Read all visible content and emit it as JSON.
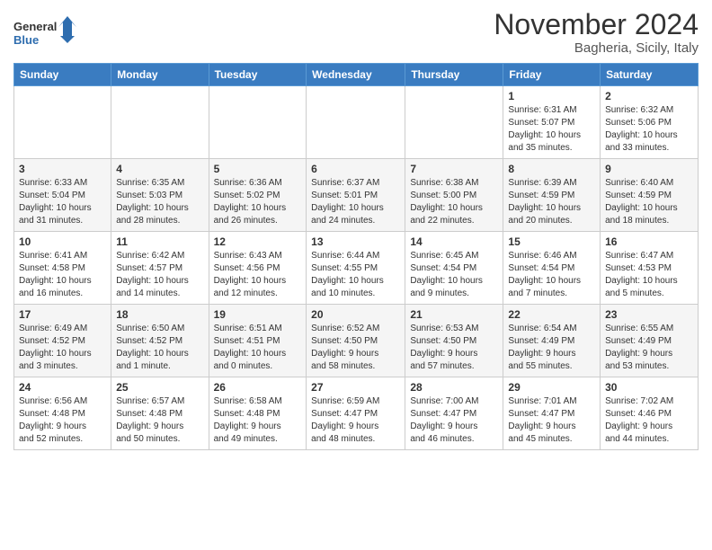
{
  "header": {
    "logo_general": "General",
    "logo_blue": "Blue",
    "month_title": "November 2024",
    "location": "Bagheria, Sicily, Italy"
  },
  "days_of_week": [
    "Sunday",
    "Monday",
    "Tuesday",
    "Wednesday",
    "Thursday",
    "Friday",
    "Saturday"
  ],
  "weeks": [
    [
      {
        "day": "",
        "info": ""
      },
      {
        "day": "",
        "info": ""
      },
      {
        "day": "",
        "info": ""
      },
      {
        "day": "",
        "info": ""
      },
      {
        "day": "",
        "info": ""
      },
      {
        "day": "1",
        "info": "Sunrise: 6:31 AM\nSunset: 5:07 PM\nDaylight: 10 hours\nand 35 minutes."
      },
      {
        "day": "2",
        "info": "Sunrise: 6:32 AM\nSunset: 5:06 PM\nDaylight: 10 hours\nand 33 minutes."
      }
    ],
    [
      {
        "day": "3",
        "info": "Sunrise: 6:33 AM\nSunset: 5:04 PM\nDaylight: 10 hours\nand 31 minutes."
      },
      {
        "day": "4",
        "info": "Sunrise: 6:35 AM\nSunset: 5:03 PM\nDaylight: 10 hours\nand 28 minutes."
      },
      {
        "day": "5",
        "info": "Sunrise: 6:36 AM\nSunset: 5:02 PM\nDaylight: 10 hours\nand 26 minutes."
      },
      {
        "day": "6",
        "info": "Sunrise: 6:37 AM\nSunset: 5:01 PM\nDaylight: 10 hours\nand 24 minutes."
      },
      {
        "day": "7",
        "info": "Sunrise: 6:38 AM\nSunset: 5:00 PM\nDaylight: 10 hours\nand 22 minutes."
      },
      {
        "day": "8",
        "info": "Sunrise: 6:39 AM\nSunset: 4:59 PM\nDaylight: 10 hours\nand 20 minutes."
      },
      {
        "day": "9",
        "info": "Sunrise: 6:40 AM\nSunset: 4:59 PM\nDaylight: 10 hours\nand 18 minutes."
      }
    ],
    [
      {
        "day": "10",
        "info": "Sunrise: 6:41 AM\nSunset: 4:58 PM\nDaylight: 10 hours\nand 16 minutes."
      },
      {
        "day": "11",
        "info": "Sunrise: 6:42 AM\nSunset: 4:57 PM\nDaylight: 10 hours\nand 14 minutes."
      },
      {
        "day": "12",
        "info": "Sunrise: 6:43 AM\nSunset: 4:56 PM\nDaylight: 10 hours\nand 12 minutes."
      },
      {
        "day": "13",
        "info": "Sunrise: 6:44 AM\nSunset: 4:55 PM\nDaylight: 10 hours\nand 10 minutes."
      },
      {
        "day": "14",
        "info": "Sunrise: 6:45 AM\nSunset: 4:54 PM\nDaylight: 10 hours\nand 9 minutes."
      },
      {
        "day": "15",
        "info": "Sunrise: 6:46 AM\nSunset: 4:54 PM\nDaylight: 10 hours\nand 7 minutes."
      },
      {
        "day": "16",
        "info": "Sunrise: 6:47 AM\nSunset: 4:53 PM\nDaylight: 10 hours\nand 5 minutes."
      }
    ],
    [
      {
        "day": "17",
        "info": "Sunrise: 6:49 AM\nSunset: 4:52 PM\nDaylight: 10 hours\nand 3 minutes."
      },
      {
        "day": "18",
        "info": "Sunrise: 6:50 AM\nSunset: 4:52 PM\nDaylight: 10 hours\nand 1 minute."
      },
      {
        "day": "19",
        "info": "Sunrise: 6:51 AM\nSunset: 4:51 PM\nDaylight: 10 hours\nand 0 minutes."
      },
      {
        "day": "20",
        "info": "Sunrise: 6:52 AM\nSunset: 4:50 PM\nDaylight: 9 hours\nand 58 minutes."
      },
      {
        "day": "21",
        "info": "Sunrise: 6:53 AM\nSunset: 4:50 PM\nDaylight: 9 hours\nand 57 minutes."
      },
      {
        "day": "22",
        "info": "Sunrise: 6:54 AM\nSunset: 4:49 PM\nDaylight: 9 hours\nand 55 minutes."
      },
      {
        "day": "23",
        "info": "Sunrise: 6:55 AM\nSunset: 4:49 PM\nDaylight: 9 hours\nand 53 minutes."
      }
    ],
    [
      {
        "day": "24",
        "info": "Sunrise: 6:56 AM\nSunset: 4:48 PM\nDaylight: 9 hours\nand 52 minutes."
      },
      {
        "day": "25",
        "info": "Sunrise: 6:57 AM\nSunset: 4:48 PM\nDaylight: 9 hours\nand 50 minutes."
      },
      {
        "day": "26",
        "info": "Sunrise: 6:58 AM\nSunset: 4:48 PM\nDaylight: 9 hours\nand 49 minutes."
      },
      {
        "day": "27",
        "info": "Sunrise: 6:59 AM\nSunset: 4:47 PM\nDaylight: 9 hours\nand 48 minutes."
      },
      {
        "day": "28",
        "info": "Sunrise: 7:00 AM\nSunset: 4:47 PM\nDaylight: 9 hours\nand 46 minutes."
      },
      {
        "day": "29",
        "info": "Sunrise: 7:01 AM\nSunset: 4:47 PM\nDaylight: 9 hours\nand 45 minutes."
      },
      {
        "day": "30",
        "info": "Sunrise: 7:02 AM\nSunset: 4:46 PM\nDaylight: 9 hours\nand 44 minutes."
      }
    ]
  ]
}
